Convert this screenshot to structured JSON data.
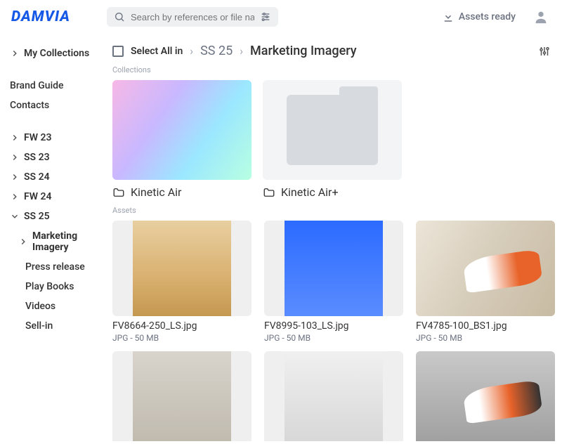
{
  "brand": "DAMVIA",
  "search": {
    "placeholder": "Search by references or file names"
  },
  "assetsReady": "Assets ready",
  "sidebar": {
    "myCollections": "My Collections",
    "brandGuide": "Brand Guide",
    "contacts": "Contacts",
    "seasons": [
      "FW 23",
      "SS 23",
      "SS 24",
      "FW 24",
      "SS 25"
    ],
    "ss25children": [
      "Marketing Imagery",
      "Press release",
      "Play Books",
      "Videos",
      "Sell-in"
    ]
  },
  "breadcrumb": {
    "selectAll": "Select All in",
    "path1": "SS 25",
    "path2": "Marketing Imagery"
  },
  "labels": {
    "collections": "Collections",
    "assets": "Assets"
  },
  "collections": [
    {
      "name": "Kinetic Air"
    },
    {
      "name": "Kinetic Air+"
    }
  ],
  "assets": [
    {
      "name": "FV8664-250_LS.jpg",
      "meta": "JPG - 50 MB"
    },
    {
      "name": "FV8995-103_LS.jpg",
      "meta": "JPG - 50 MB"
    },
    {
      "name": "FV4785-100_BS1.jpg",
      "meta": "JPG - 50 MB"
    },
    {
      "name": "",
      "meta": ""
    },
    {
      "name": "",
      "meta": ""
    },
    {
      "name": "",
      "meta": ""
    }
  ]
}
